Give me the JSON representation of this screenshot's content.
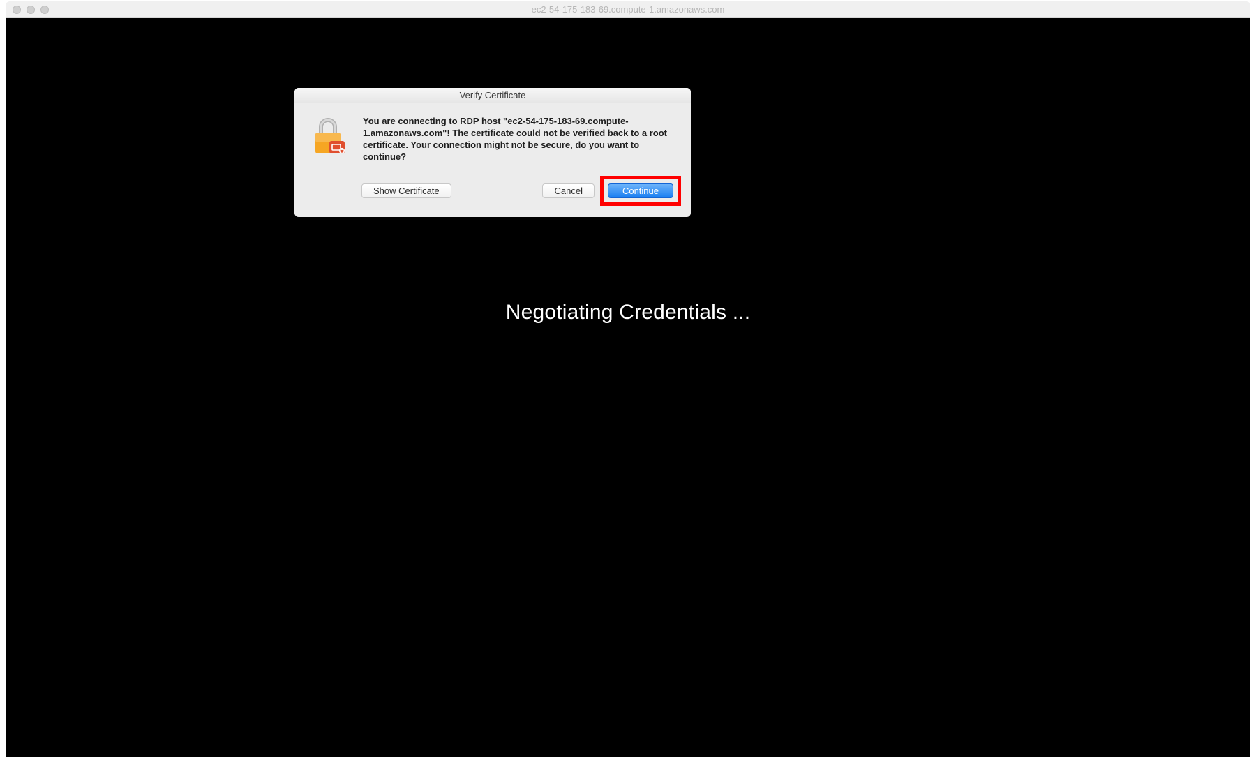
{
  "window": {
    "title": "ec2-54-175-183-69.compute-1.amazonaws.com"
  },
  "background": {
    "status_text": "Negotiating Credentials ..."
  },
  "dialog": {
    "title": "Verify Certificate",
    "message": "You are connecting to RDP host \"ec2-54-175-183-69.compute-1.amazonaws.com\"! The certificate could not be verified back to a root certificate. Your connection might not be secure, do you want to continue?",
    "buttons": {
      "show_certificate": "Show Certificate",
      "cancel": "Cancel",
      "continue": "Continue"
    },
    "icon_name": "lock-certificate-icon"
  },
  "annotation": {
    "highlighted_button": "continue"
  }
}
